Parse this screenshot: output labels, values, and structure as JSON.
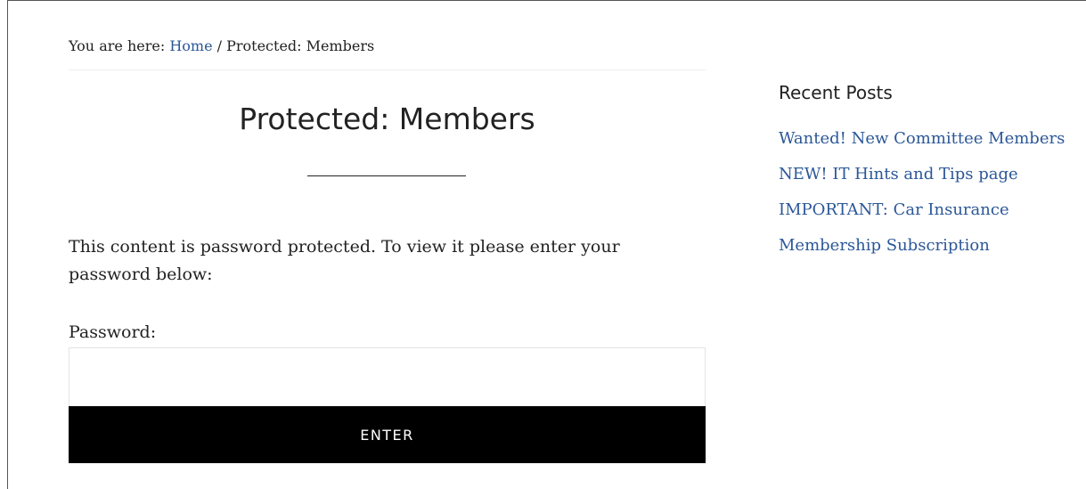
{
  "breadcrumb": {
    "prefix": "You are here: ",
    "home_label": "Home",
    "separator": " / ",
    "current": "Protected: Members"
  },
  "page": {
    "title": "Protected: Members",
    "notice": "This content is password protected. To view it please enter your password below:",
    "password_label": "Password:",
    "password_value": "",
    "enter_label": "ENTER"
  },
  "sidebar": {
    "title": "Recent Posts",
    "posts": [
      {
        "label": "Wanted! New Committee Members"
      },
      {
        "label": "NEW! IT Hints and Tips page"
      },
      {
        "label": "IMPORTANT: Car Insurance"
      },
      {
        "label": "Membership Subscription"
      }
    ]
  },
  "colors": {
    "link": "#2b5797",
    "text": "#222222",
    "button_bg": "#000000",
    "button_text": "#ffffff"
  }
}
